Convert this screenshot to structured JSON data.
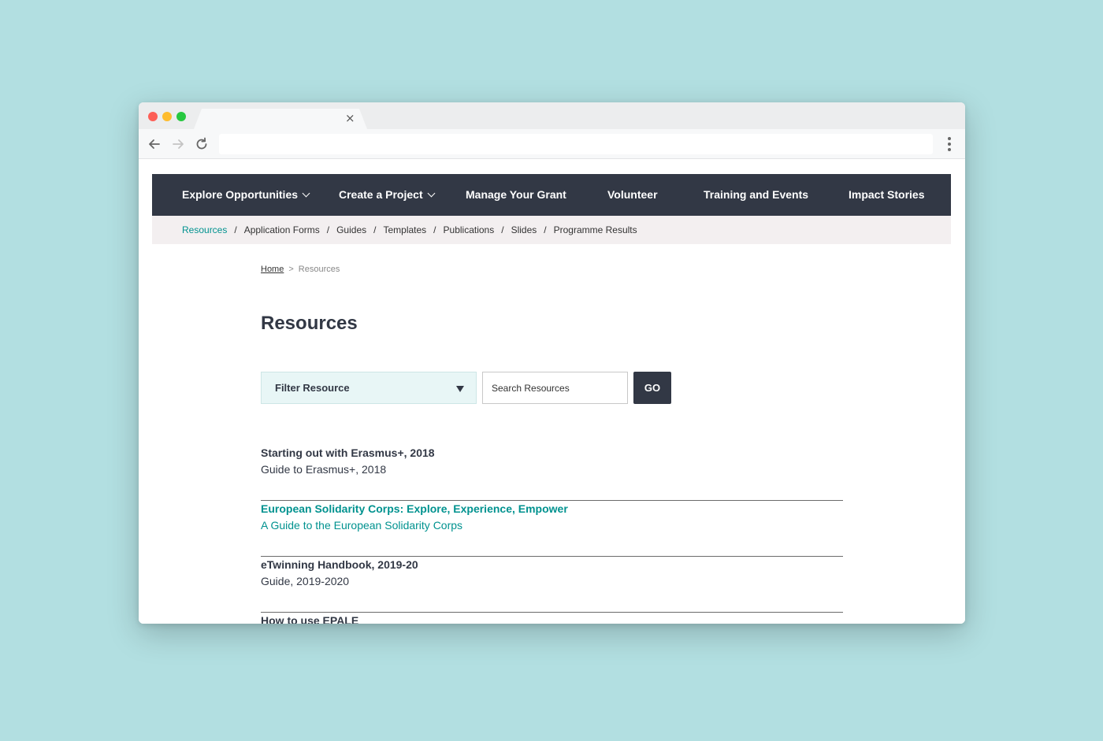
{
  "browser": {
    "tab_close": "×"
  },
  "main_nav": {
    "items": [
      {
        "label": "Explore Opportunities"
      },
      {
        "label": "Create a Project"
      },
      {
        "label": "Manage Your Grant"
      },
      {
        "label": "Volunteer"
      },
      {
        "label": "Training and Events"
      },
      {
        "label": "Impact Stories"
      }
    ]
  },
  "sub_nav": {
    "separator": "/",
    "items": [
      {
        "label": "Resources"
      },
      {
        "label": "Application Forms"
      },
      {
        "label": "Guides"
      },
      {
        "label": "Templates"
      },
      {
        "label": "Publications"
      },
      {
        "label": "Slides"
      },
      {
        "label": "Programme Results"
      }
    ]
  },
  "breadcrumb": {
    "home": "Home",
    "separator": ">",
    "current": "Resources"
  },
  "page_title": "Resources",
  "filter": {
    "label": "Filter Resource"
  },
  "search": {
    "placeholder": "Search Resources",
    "button": "GO"
  },
  "resources": [
    {
      "title": "Starting out with Erasmus+, 2018",
      "subtitle": "Guide to Erasmus+, 2018"
    },
    {
      "title": "European Solidarity Corps: Explore, Experience, Empower",
      "subtitle": "A Guide to the European Solidarity Corps"
    },
    {
      "title": "eTwinning Handbook, 2019-20",
      "subtitle": "Guide, 2019-2020"
    },
    {
      "title": "How to use EPALE",
      "subtitle": ""
    }
  ],
  "colors": {
    "nav_bg": "#323845",
    "accent": "#00928f",
    "subnav_bg": "#f3eff0",
    "filter_bg": "#e8f6f6",
    "backdrop": "#b2dfe1"
  }
}
